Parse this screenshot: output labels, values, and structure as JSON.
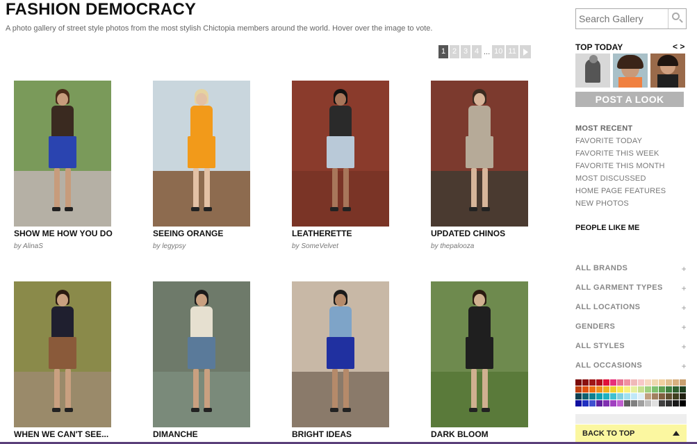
{
  "header": {
    "title": "FASHION DEMOCRACY",
    "subtitle": "A photo gallery of street style photos from the most stylish Chictopia members around the world. Hover over the image to vote."
  },
  "pagination": {
    "pages": [
      "1",
      "2",
      "3",
      "4"
    ],
    "ellipsis": "...",
    "tail_pages": [
      "10",
      "11"
    ],
    "current": "1"
  },
  "gallery": [
    {
      "caption": "SHOW ME HOW YOU DO",
      "byline": "by AlinaS",
      "bg": "#7a9a5a",
      "ground": "#b5b0a5",
      "top": "#3a2a20",
      "bottom": "#2a44b0",
      "skin": "#c79c7c",
      "hair": "#4a2a18"
    },
    {
      "caption": "SEEING ORANGE",
      "byline": "by legypsy",
      "bg": "#c9d6dd",
      "ground": "#8d6b4f",
      "top": "#f29a1a",
      "bottom": "#f29a1a",
      "skin": "#e3c1a5",
      "hair": "#e5d3a0"
    },
    {
      "caption": "LEATHERETTE",
      "byline": "by SomeVelvet",
      "bg": "#8a3b2c",
      "ground": "#7a3426",
      "top": "#2a2a2a",
      "bottom": "#b9c9d8",
      "skin": "#a8765a",
      "hair": "#111111"
    },
    {
      "caption": "UPDATED CHINOS",
      "byline": "by thepalooza",
      "bg": "#7c3a2e",
      "ground": "#4a3a30",
      "top": "#b6aa98",
      "bottom": "#b6aa98",
      "skin": "#d7b59a",
      "hair": "#3a2a20"
    },
    {
      "caption": "WHEN WE CAN'T SEE...",
      "byline": "",
      "bg": "#8a8a4a",
      "ground": "#9a8a6a",
      "top": "#1f1f2f",
      "bottom": "#8a5a3a",
      "skin": "#c9a080",
      "hair": "#2a1a10"
    },
    {
      "caption": "DIMANCHE",
      "byline": "",
      "bg": "#6e7a6a",
      "ground": "#7a8a7a",
      "top": "#e6e0d0",
      "bottom": "#5a7a9a",
      "skin": "#c9a080",
      "hair": "#1a1a1a"
    },
    {
      "caption": "BRIGHT IDEAS",
      "byline": "",
      "bg": "#c8b8a6",
      "ground": "#8a7a6a",
      "top": "#7ea4c8",
      "bottom": "#2030a0",
      "skin": "#b58a6a",
      "hair": "#1a1a1a"
    },
    {
      "caption": "DARK BLOOM",
      "byline": "",
      "bg": "#6e8a4e",
      "ground": "#5a7a3a",
      "top": "#1f1f1f",
      "bottom": "#1f1f1f",
      "skin": "#d0b090",
      "hair": "#2a1a10"
    }
  ],
  "sidebar": {
    "search_placeholder": "Search Gallery",
    "search_icon": "magnifier-icon",
    "top_today_label": "TOP TODAY",
    "top_today_nav": "< >",
    "post_look_label": "POST A LOOK",
    "filters": [
      "MOST RECENT",
      "FAVORITE TODAY",
      "FAVORITE THIS WEEK",
      "FAVORITE THIS MONTH",
      "MOST DISCUSSED",
      "HOME PAGE FEATURES",
      "NEW PHOTOS"
    ],
    "filters_selected": "MOST RECENT",
    "people_like_me": "PEOPLE LIKE ME",
    "categories": [
      "ALL BRANDS",
      "ALL GARMENT TYPES",
      "ALL LOCATIONS",
      "GENDERS",
      "ALL STYLES",
      "ALL OCCASIONS"
    ],
    "expand_symbol": "+",
    "back_to_top": "BACK TO TOP",
    "swatch_colors": [
      "#7a0a0a",
      "#8a1010",
      "#a01818",
      "#b0101a",
      "#e0103a",
      "#e8307a",
      "#e87090",
      "#f090a0",
      "#f0b8b8",
      "#f8c8c8",
      "#f8d8c0",
      "#f0d8b0",
      "#f0d0a0",
      "#e0c090",
      "#d8b080",
      "#c8a070",
      "#c04010",
      "#e05010",
      "#f07010",
      "#f09020",
      "#f0b020",
      "#f0d030",
      "#f8e850",
      "#f8f080",
      "#e8f0a0",
      "#c8e090",
      "#a0d080",
      "#80c070",
      "#60a050",
      "#408040",
      "#306030",
      "#204020",
      "#104050",
      "#106070",
      "#108090",
      "#10a0b0",
      "#20b0c0",
      "#40c0d0",
      "#80d0e0",
      "#a0e0f0",
      "#c0e8f8",
      "#e0f0f8",
      "#c0a080",
      "#a08060",
      "#806040",
      "#605030",
      "#404020",
      "#202010",
      "#1010a0",
      "#2030c0",
      "#4050d0",
      "#6020a0",
      "#8030b0",
      "#a040c0",
      "#c060d0",
      "#606060",
      "#808080",
      "#a0a0a0",
      "#c0c0c0",
      "#e0e0e0",
      "#404040",
      "#303030",
      "#181818",
      "#000000"
    ]
  }
}
